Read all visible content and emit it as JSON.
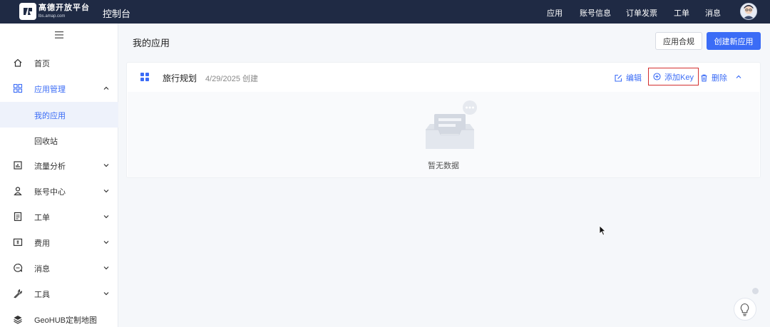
{
  "header": {
    "brand_name": "高德开放平台",
    "brand_sub": "lbs.amap.com",
    "console": "控制台",
    "nav": [
      "应用",
      "账号信息",
      "订单发票",
      "工单",
      "消息"
    ]
  },
  "sidebar": {
    "items": [
      {
        "label": "首页",
        "icon": "home-icon"
      },
      {
        "label": "应用管理",
        "icon": "grid-icon",
        "open": true
      },
      {
        "label": "我的应用",
        "sub": true,
        "active": true
      },
      {
        "label": "回收站",
        "sub": true
      },
      {
        "label": "流量分析",
        "icon": "chart-icon"
      },
      {
        "label": "账号中心",
        "icon": "user-icon"
      },
      {
        "label": "工单",
        "icon": "ticket-icon"
      },
      {
        "label": "费用",
        "icon": "fee-icon"
      },
      {
        "label": "消息",
        "icon": "message-icon"
      },
      {
        "label": "工具",
        "icon": "wrench-icon"
      },
      {
        "label": "GeoHUB定制地图",
        "icon": "layers-icon"
      }
    ]
  },
  "main": {
    "title": "我的应用",
    "btn_compliance": "应用合规",
    "btn_create": "创建新应用",
    "app": {
      "name": "旅行规划",
      "created": "4/29/2025 创建",
      "edit": "编辑",
      "add_key": "添加Key",
      "delete": "删除",
      "empty": "暂无数据"
    }
  },
  "colors": {
    "accent": "#3b6cf6",
    "header_bg": "#1f2a44",
    "highlight": "#d32f2f"
  }
}
